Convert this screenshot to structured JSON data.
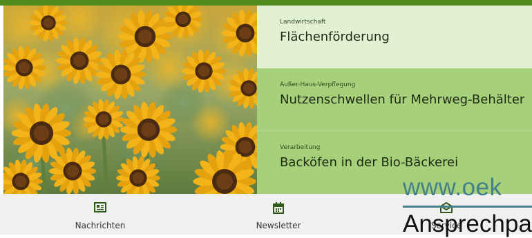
{
  "teasers": [
    {
      "category": "Landwirtschaft",
      "title": "Flächenförderung"
    },
    {
      "category": "Außer-Haus-Verpflegung",
      "title": "Nutzenschwellen für Mehrweg-Behälter"
    },
    {
      "category": "Verarbeitung",
      "title": "Backöfen in der Bio-Bäckerei"
    }
  ],
  "nav": [
    {
      "label": "Nachrichten",
      "icon": "newspaper-icon"
    },
    {
      "label": "Newsletter",
      "icon": "calendar-icon"
    },
    {
      "label": "Service",
      "icon": "envelope-open-icon"
    }
  ],
  "overlay": {
    "url": "www.oek",
    "contact": "Ansprechpa"
  },
  "colors": {
    "accent": "#4f8a1a",
    "active_item": "#e3f1d3",
    "item": "#a7d07a",
    "nav_bg": "#f0f0f0",
    "link": "#43808a"
  }
}
